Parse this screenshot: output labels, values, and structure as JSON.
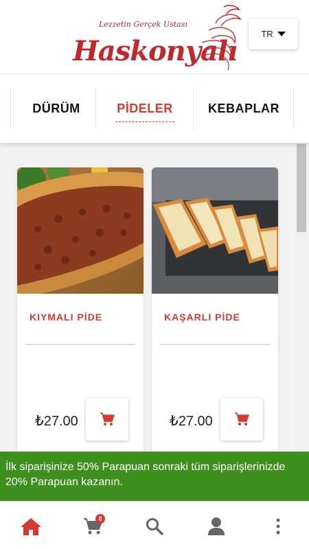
{
  "header": {
    "tagline": "Lezzetin Gerçek Ustası",
    "brand": "Haskonyalı",
    "language": "TR"
  },
  "tabs": [
    {
      "label": "DÜRÜM",
      "active": false
    },
    {
      "label": "PİDELER",
      "active": true
    },
    {
      "label": "KEBAPLAR",
      "active": false
    }
  ],
  "products": [
    {
      "name": "KIYMALI PİDE",
      "price": "₺27.00"
    },
    {
      "name": "KAŞARLI PİDE",
      "price": "₺27.00"
    }
  ],
  "promo": {
    "text": "İlk siparişinize 50% Parapuan sonraki tüm siparişlerinizde 20% Parapuan kazanın."
  },
  "bottom_nav": {
    "cart_count": "0",
    "items": [
      "home-icon",
      "cart-icon",
      "search-icon",
      "user-icon",
      "more-icon"
    ]
  },
  "colors": {
    "accent": "#d43a2f",
    "promo_bg": "#3f8f1e",
    "brand_red": "#c0282d"
  }
}
